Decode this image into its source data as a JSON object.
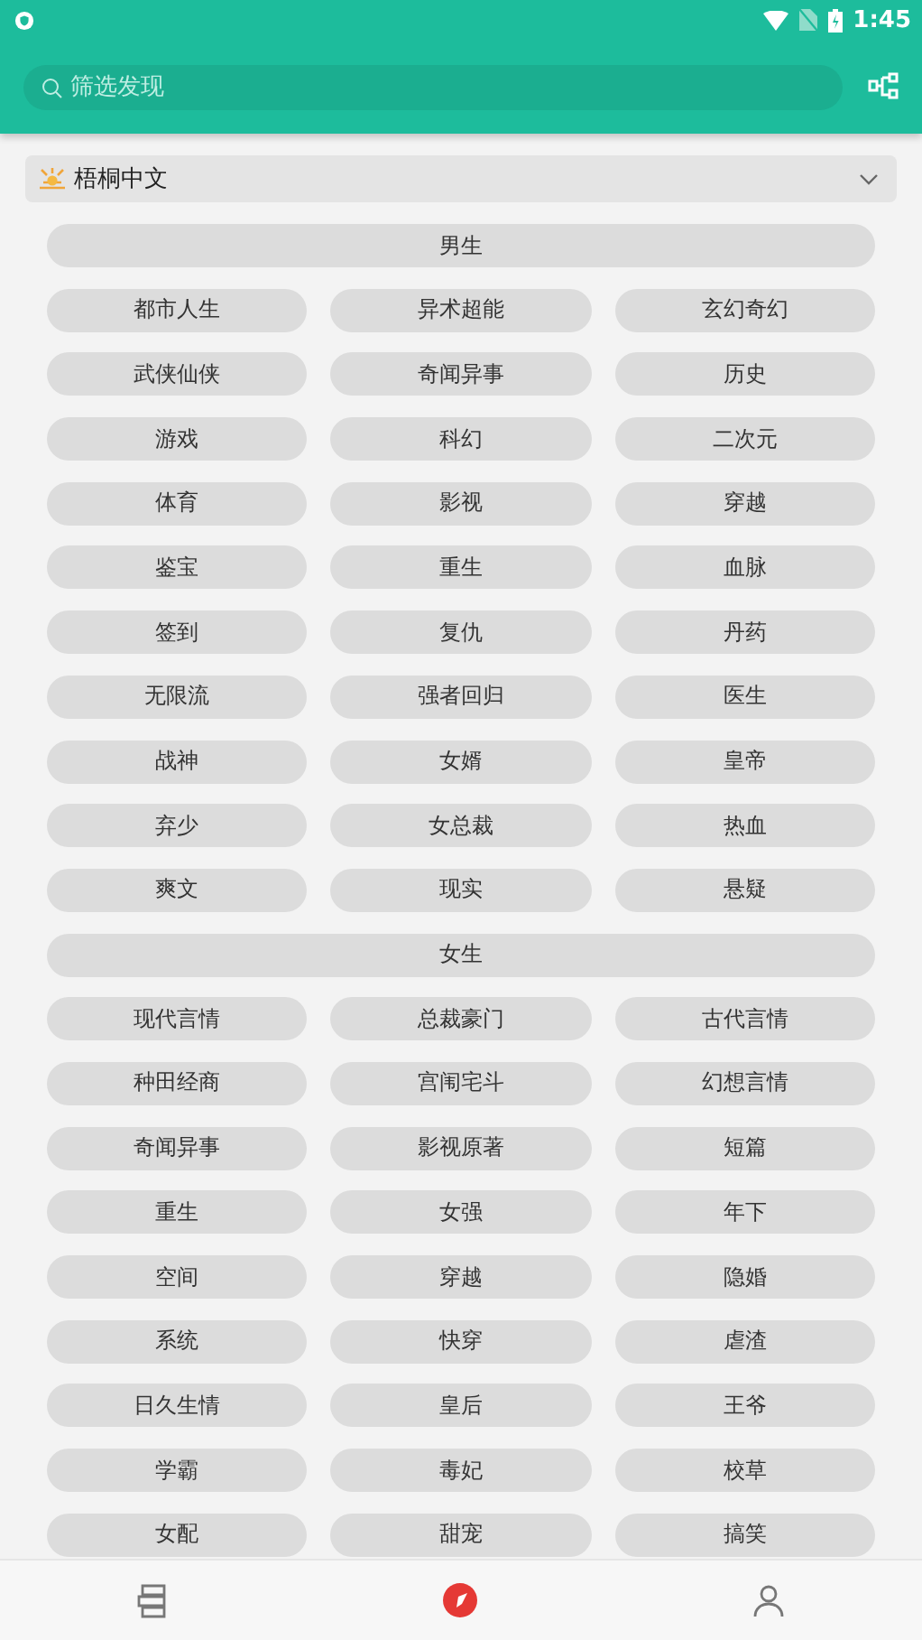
{
  "status_bar": {
    "time": "1:45"
  },
  "search": {
    "placeholder": "筛选发现"
  },
  "source": {
    "name": "梧桐中文"
  },
  "sections": [
    {
      "title": "男生",
      "tags": [
        "都市人生",
        "异术超能",
        "玄幻奇幻",
        "武侠仙侠",
        "奇闻异事",
        "历史",
        "游戏",
        "科幻",
        "二次元",
        "体育",
        "影视",
        "穿越",
        "鉴宝",
        "重生",
        "血脉",
        "签到",
        "复仇",
        "丹药",
        "无限流",
        "强者回归",
        "医生",
        "战神",
        "女婿",
        "皇帝",
        "弃少",
        "女总裁",
        "热血",
        "爽文",
        "现实",
        "悬疑"
      ]
    },
    {
      "title": "女生",
      "tags": [
        "现代言情",
        "总裁豪门",
        "古代言情",
        "种田经商",
        "宫闱宅斗",
        "幻想言情",
        "奇闻异事",
        "影视原著",
        "短篇",
        "重生",
        "女强",
        "年下",
        "空间",
        "穿越",
        "隐婚",
        "系统",
        "快穿",
        "虐渣",
        "日久生情",
        "皇后",
        "王爷",
        "学霸",
        "毒妃",
        "校草",
        "女配",
        "甜宠",
        "搞笑"
      ]
    }
  ],
  "bottom_nav": [
    {
      "kind": "books",
      "selected": false
    },
    {
      "kind": "compass",
      "selected": true
    },
    {
      "kind": "person",
      "selected": false
    }
  ]
}
